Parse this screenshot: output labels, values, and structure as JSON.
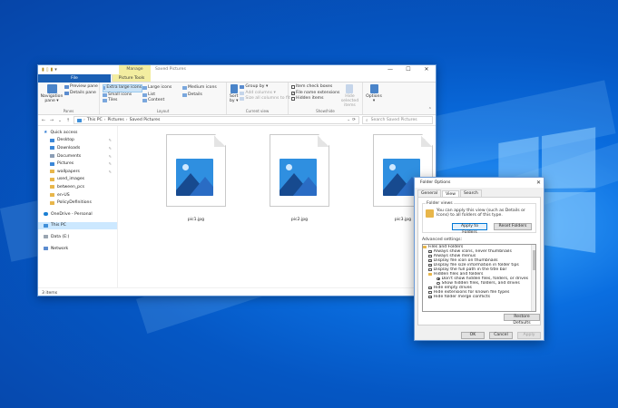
{
  "window": {
    "title": "Saved Pictures",
    "context_tab": "Manage",
    "controls": [
      "—",
      "☐",
      "✕"
    ]
  },
  "ribbon_tabs": [
    "File",
    "Home",
    "Share",
    "View",
    "Picture Tools"
  ],
  "ribbon": {
    "panes": {
      "navigation_pane": "Navigation pane ▾",
      "preview_pane": "Preview pane",
      "details_pane": "Details pane",
      "label": "Panes"
    },
    "layout": {
      "items": [
        "Extra large icons",
        "Large icons",
        "Medium icons",
        "Small icons",
        "List",
        "Details",
        "Tiles",
        "Content"
      ],
      "label": "Layout"
    },
    "current_view": {
      "sort_by": "Sort by ▾",
      "group_by": "Group by ▾",
      "add_columns": "Add columns ▾",
      "size_columns": "Size all columns to fit",
      "label": "Current view"
    },
    "show_hide": {
      "item_check_boxes": "Item check boxes",
      "file_name_extensions": "File name extensions",
      "hidden_items": "Hidden items",
      "hide_selected": "Hide selected items",
      "label": "Show/hide"
    },
    "options": "Options ▾"
  },
  "address": {
    "crumbs": [
      "This PC",
      "Pictures",
      "Saved Pictures"
    ],
    "search_placeholder": "Search Saved Pictures"
  },
  "nav": {
    "items": [
      {
        "label": "Quick access",
        "icon": "star-icon",
        "indent": false,
        "pinned": false
      },
      {
        "label": "Desktop",
        "icon": "desktop-icon",
        "indent": true,
        "pinned": true
      },
      {
        "label": "Downloads",
        "icon": "download-icon",
        "indent": true,
        "pinned": true
      },
      {
        "label": "Documents",
        "icon": "documents-icon",
        "indent": true,
        "pinned": true
      },
      {
        "label": "Pictures",
        "icon": "pictures-icon",
        "indent": true,
        "pinned": true
      },
      {
        "label": "wallpapers",
        "icon": "folder-icon",
        "indent": true,
        "pinned": true
      },
      {
        "label": "used_images",
        "icon": "folder-icon",
        "indent": true,
        "pinned": false
      },
      {
        "label": "between_pcs",
        "icon": "folder-icon",
        "indent": true,
        "pinned": false
      },
      {
        "label": "en-US",
        "icon": "folder-icon",
        "indent": true,
        "pinned": false
      },
      {
        "label": "PolicyDefinitions",
        "icon": "folder-icon",
        "indent": true,
        "pinned": false
      }
    ],
    "onedrive": "OneDrive - Personal",
    "this_pc": "This PC",
    "data_drive": "Data (E:)",
    "network": "Network"
  },
  "files": [
    "pic1.jpg",
    "pic2.jpg",
    "pic3.jpg"
  ],
  "status": {
    "count": "3 items"
  },
  "dialog": {
    "title": "Folder Options",
    "close": "✕",
    "tabs": [
      "General",
      "View",
      "Search"
    ],
    "folder_views": {
      "legend": "Folder views",
      "text": "You can apply this view (such as Details or Icons) to all folders of this type.",
      "apply": "Apply to Folders",
      "reset": "Reset Folders"
    },
    "advanced_label": "Advanced settings:",
    "advanced": [
      {
        "label": "Files and Folders",
        "kind": "folder",
        "level": 0
      },
      {
        "label": "Always show icons, never thumbnails",
        "kind": "check",
        "level": 1,
        "checked": true
      },
      {
        "label": "Always show menus",
        "kind": "check",
        "level": 1,
        "checked": false
      },
      {
        "label": "Display file icon on thumbnails",
        "kind": "check",
        "level": 1,
        "checked": true
      },
      {
        "label": "Display file size information in folder tips",
        "kind": "check",
        "level": 1,
        "checked": true
      },
      {
        "label": "Display the full path in the title bar",
        "kind": "check",
        "level": 1,
        "checked": false
      },
      {
        "label": "Hidden files and folders",
        "kind": "folder",
        "level": 1
      },
      {
        "label": "Don't show hidden files, folders, or drives",
        "kind": "radio",
        "level": 2,
        "checked": true
      },
      {
        "label": "Show hidden files, folders, and drives",
        "kind": "radio",
        "level": 2,
        "checked": false
      },
      {
        "label": "Hide empty drives",
        "kind": "check",
        "level": 1,
        "checked": true
      },
      {
        "label": "Hide extensions for known file types",
        "kind": "check",
        "level": 1,
        "checked": false
      },
      {
        "label": "Hide folder merge conflicts",
        "kind": "check",
        "level": 1,
        "checked": true
      }
    ],
    "restore_defaults": "Restore Defaults",
    "ok": "OK",
    "cancel": "Cancel",
    "apply": "Apply"
  }
}
